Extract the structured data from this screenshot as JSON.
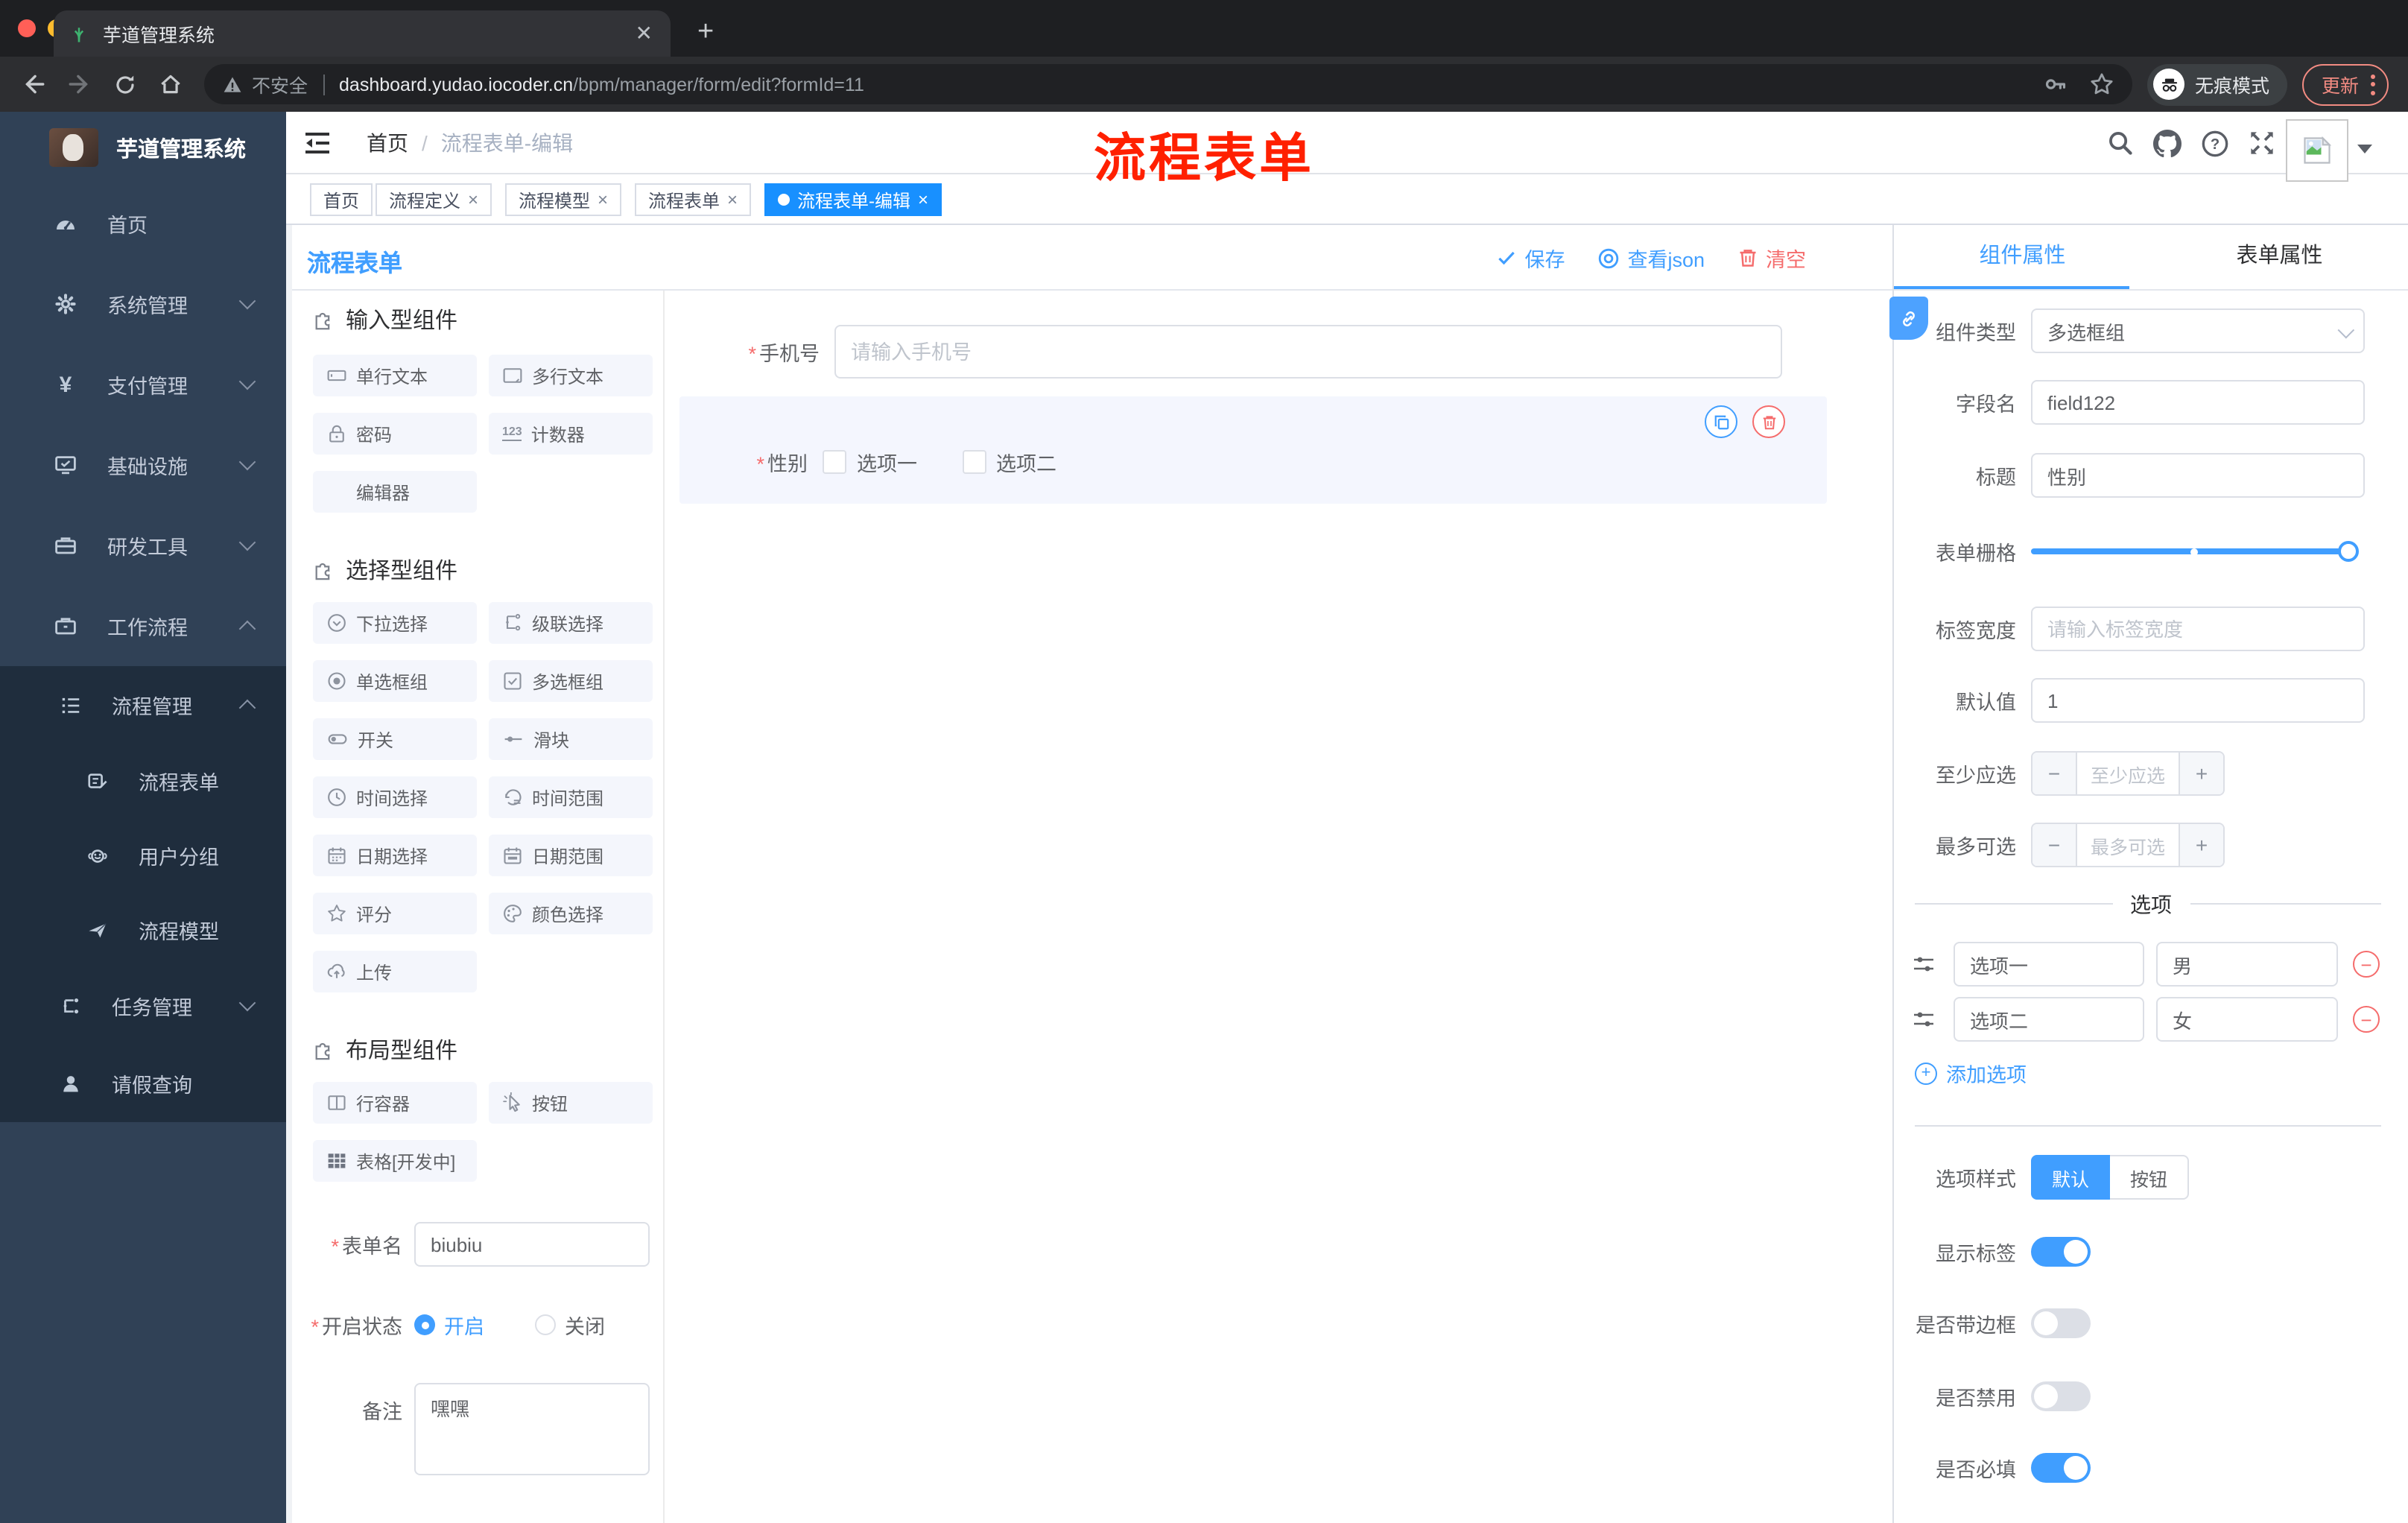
{
  "browser": {
    "tab_title": "芋道管理系统",
    "close_tab": "✕",
    "new_tab": "+",
    "security": "不安全",
    "url_host": "dashboard.yudao.iocoder.cn",
    "url_path": "/bpm/manager/form/edit?formId=11",
    "incognito_label": "无痕模式",
    "update_label": "更新"
  },
  "sidebar": {
    "logo_title": "芋道管理系统",
    "items": [
      {
        "label": "首页"
      },
      {
        "label": "系统管理"
      },
      {
        "label": "支付管理"
      },
      {
        "label": "基础设施"
      },
      {
        "label": "研发工具"
      },
      {
        "label": "工作流程"
      },
      {
        "label": "流程管理"
      },
      {
        "label": "流程表单"
      },
      {
        "label": "用户分组"
      },
      {
        "label": "流程模型"
      },
      {
        "label": "任务管理"
      },
      {
        "label": "请假查询"
      }
    ]
  },
  "header": {
    "breadcrumb_home": "首页",
    "breadcrumb_sep": "/",
    "breadcrumb_current": "流程表单-编辑",
    "annotation": "流程表单"
  },
  "tags": [
    {
      "label": "首页"
    },
    {
      "label": "流程定义"
    },
    {
      "label": "流程模型"
    },
    {
      "label": "流程表单"
    },
    {
      "label": "流程表单-编辑"
    }
  ],
  "designer": {
    "title": "流程表单",
    "actions": {
      "save": "保存",
      "view_json": "查看json",
      "clear": "清空"
    },
    "palette": {
      "sections": [
        {
          "title": "输入型组件",
          "items": [
            "单行文本",
            "多行文本",
            "密码",
            "计数器",
            "编辑器"
          ]
        },
        {
          "title": "选择型组件",
          "items": [
            "下拉选择",
            "级联选择",
            "单选框组",
            "多选框组",
            "开关",
            "滑块",
            "时间选择",
            "时间范围",
            "日期选择",
            "日期范围",
            "评分",
            "颜色选择",
            "上传"
          ]
        },
        {
          "title": "布局型组件",
          "items": [
            "行容器",
            "按钮",
            "表格[开发中]"
          ]
        }
      ]
    },
    "meta_form": {
      "form_name_label": "表单名",
      "form_name_value": "biubiu",
      "status_label": "开启状态",
      "status_on": "开启",
      "status_off": "关闭",
      "remark_label": "备注",
      "remark_value": "嘿嘿"
    },
    "canvas": {
      "phone_label": "手机号",
      "phone_placeholder": "请输入手机号",
      "gender_label": "性别",
      "gender_option1": "选项一",
      "gender_option2": "选项二"
    }
  },
  "inspector": {
    "tab_component": "组件属性",
    "tab_form": "表单属性",
    "component_type_label": "组件类型",
    "component_type_value": "多选框组",
    "field_name_label": "字段名",
    "field_name_value": "field122",
    "title_label": "标题",
    "title_value": "性别",
    "grid_label": "表单栅格",
    "label_width_label": "标签宽度",
    "label_width_placeholder": "请输入标签宽度",
    "default_label": "默认值",
    "default_value": "1",
    "min_label": "至少应选",
    "min_placeholder": "至少应选",
    "max_label": "最多可选",
    "max_placeholder": "最多可选",
    "options_divider": "选项",
    "options": [
      {
        "label": "选项一",
        "value": "男"
      },
      {
        "label": "选项二",
        "value": "女"
      }
    ],
    "add_option": "添加选项",
    "style_label": "选项样式",
    "style_default": "默认",
    "style_button": "按钮",
    "toggles": [
      {
        "label": "显示标签",
        "on": true
      },
      {
        "label": "是否带边框",
        "on": false
      },
      {
        "label": "是否禁用",
        "on": false
      },
      {
        "label": "是否必填",
        "on": true
      }
    ]
  },
  "colors": {
    "primary": "#409eff",
    "tag_active": "#1890ff",
    "danger": "#f56c6c",
    "annotation_red": "#ff2000",
    "sidebar_bg": "#304156",
    "submenu_bg": "#1f2d3d"
  }
}
